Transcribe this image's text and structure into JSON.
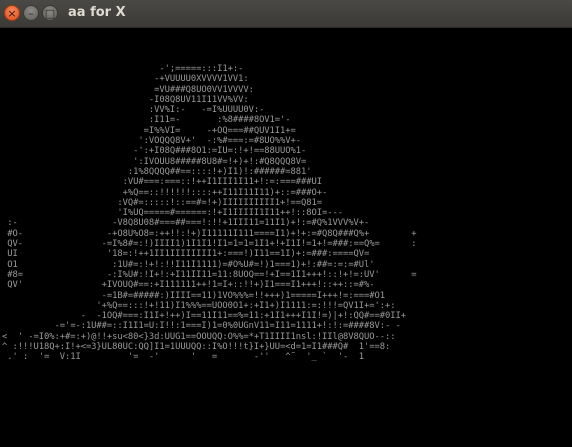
{
  "window": {
    "title": "aa for X",
    "close_icon": "×",
    "minimize_icon": "–",
    "maximize_icon": "□"
  },
  "terminal": {
    "ascii_art": "                              -';=====:::I1+:-\n                             -+VUUUU0XVVVV1VV1:\n                             =VU###Q8UO0VV1VVVV:\n                            -I08Q8UV11I11VV%VV:\n                            :VV%I:-   -=I%UUUU0V:-\n                            :I11=-       :%8####8OV1='-\n                           =I%%VI=     -+OQ===##QUV1I1+=\n                          ':VOQQQ8V+'  -:%#===:=#8UO%%V+-\n                         -':+I08Q###8O1:=IU=:!+!==88UUO%1-\n                         ':IVOUU8#####8U8#=!+)+!:#Q8QQQ8V=\n                        :1%8QQQQ##==::::!+)I1)!:######=881'\n                       :VU#===:===::!++I1III1I11+!:=:===###UI\n                       +%Q==::!!!!!!::::++I11I11I11)+::=###O+-\n                      :VQ#=:::::!::==#=!+)IIIIIIIIII1+!==Q81=\n                      'I%UQ=====#======:!+I1IIIII1I11++!::8OI=---\n :-                  -V8Q8U08#===##===!:!!+1III11=11I1)+!:=#Q%1VVV%V+-\n #O-                -+O8U%O8=:++!!:!+)I11111I111====I1)+!+:=#Q8Q###Q%+        +\n QV-               -=I%8#=:!)IIII1)1I1I1!I1=1=1=1I1+!+I1I!=1+!=###:==Q%=      :\n UI                 '18=:!++1II1IIIIIIII1+:===!)I11==1I)+:=###:====QV=\n O1                  :1U#=:!+!:!!I11I1111)=#O%U#=!)1===1)+!:##=:=:=#Ul'\n #8=                -:I%U#:!I+!:+I11II11=11:8UOQ==!+I==1I1+++!::!+!=:UV'      =\n QV'               +IVOUQ#==:+I111111++!1=I+::!!+)I1===I1+++!::++::=#%-\n                   -=1B#=#####:)IIII==11)1VO%%%=!!+++)1=====I+++!=:===#O1\n                  '+%Q==:::!+!11)I1%%%==UOO0O1+:+I1+)I1111:=:!!!=QV1I+=':+:\n               -  -1OQ#===:I1I+!++)I==11I11==%=11:+1I1+++I1I!=)|+!:QQ#==#0II+\n          -='=-:1U##=::I1I1=U:I!!:1===I)1=0%0UGnV11=I11=1111+!:!:=####8V:- -\n<  ' -=I0%:+#=:+)@!!+su<80<}3d:UUG1==OOUQQ:O%%=*+T1IIII1nsl:!IIl@8V8QUO--::\n^ :!!!U18Q+:I!+<=3}UL80UC:QQ]I1=1UUUQQ::I%O!!!t}I+}UU=<d=1=I1###Q#  1'==8:\n .' :  '=  V:1I         '=  -'      '   =       -''   ^˜  '_ `  '-  1"
  }
}
